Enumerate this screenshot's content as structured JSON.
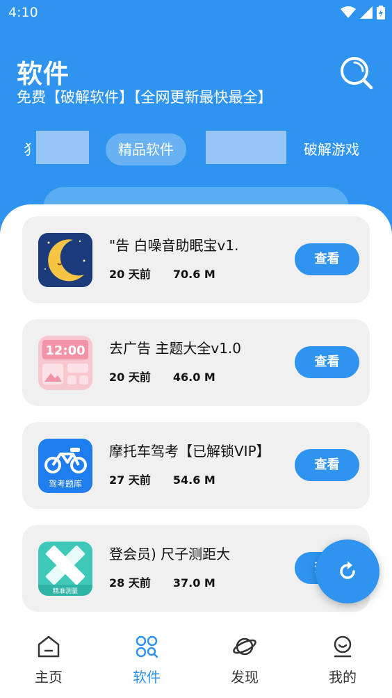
{
  "status": {
    "time": "4:10"
  },
  "header": {
    "title": "软件",
    "subtitle": "免费【破解软件】【全网更新最快最全】",
    "tabs": [
      {
        "label": "精品软件",
        "active": true
      },
      {
        "label": "破解游戏",
        "active": false
      }
    ]
  },
  "cards": [
    {
      "name": "\"告                  白噪音助眠宝v1.",
      "age": "20 天前",
      "size": "70.6 M",
      "button": "查看",
      "icon": "moon-app-icon"
    },
    {
      "name": "去广告                   主题大全v1.0",
      "age": "20 天前",
      "size": "46.0 M",
      "button": "查看",
      "icon": "theme-app-icon"
    },
    {
      "name": "摩托车驾考【已解锁VIP】",
      "age": "27 天前",
      "size": "54.6 M",
      "button": "查看",
      "icon": "motorcycle-app-icon"
    },
    {
      "name": "登会员)                  尺子测距大",
      "age": "28 天前",
      "size": "37.0 M",
      "button": "查看",
      "icon": "ruler-app-icon"
    }
  ],
  "icon_texts": {
    "theme_time": "12:00",
    "moto_label": "驾考题库",
    "ruler_label": "精准测量"
  },
  "nav": [
    {
      "label": "主页",
      "icon": "home-icon",
      "active": false
    },
    {
      "label": "软件",
      "icon": "apps-icon",
      "active": true
    },
    {
      "label": "发现",
      "icon": "planet-icon",
      "active": false
    },
    {
      "label": "我的",
      "icon": "smile-icon",
      "active": false
    }
  ],
  "colors": {
    "primary": "#2f94ef",
    "card_bg": "#f0f0f0"
  }
}
